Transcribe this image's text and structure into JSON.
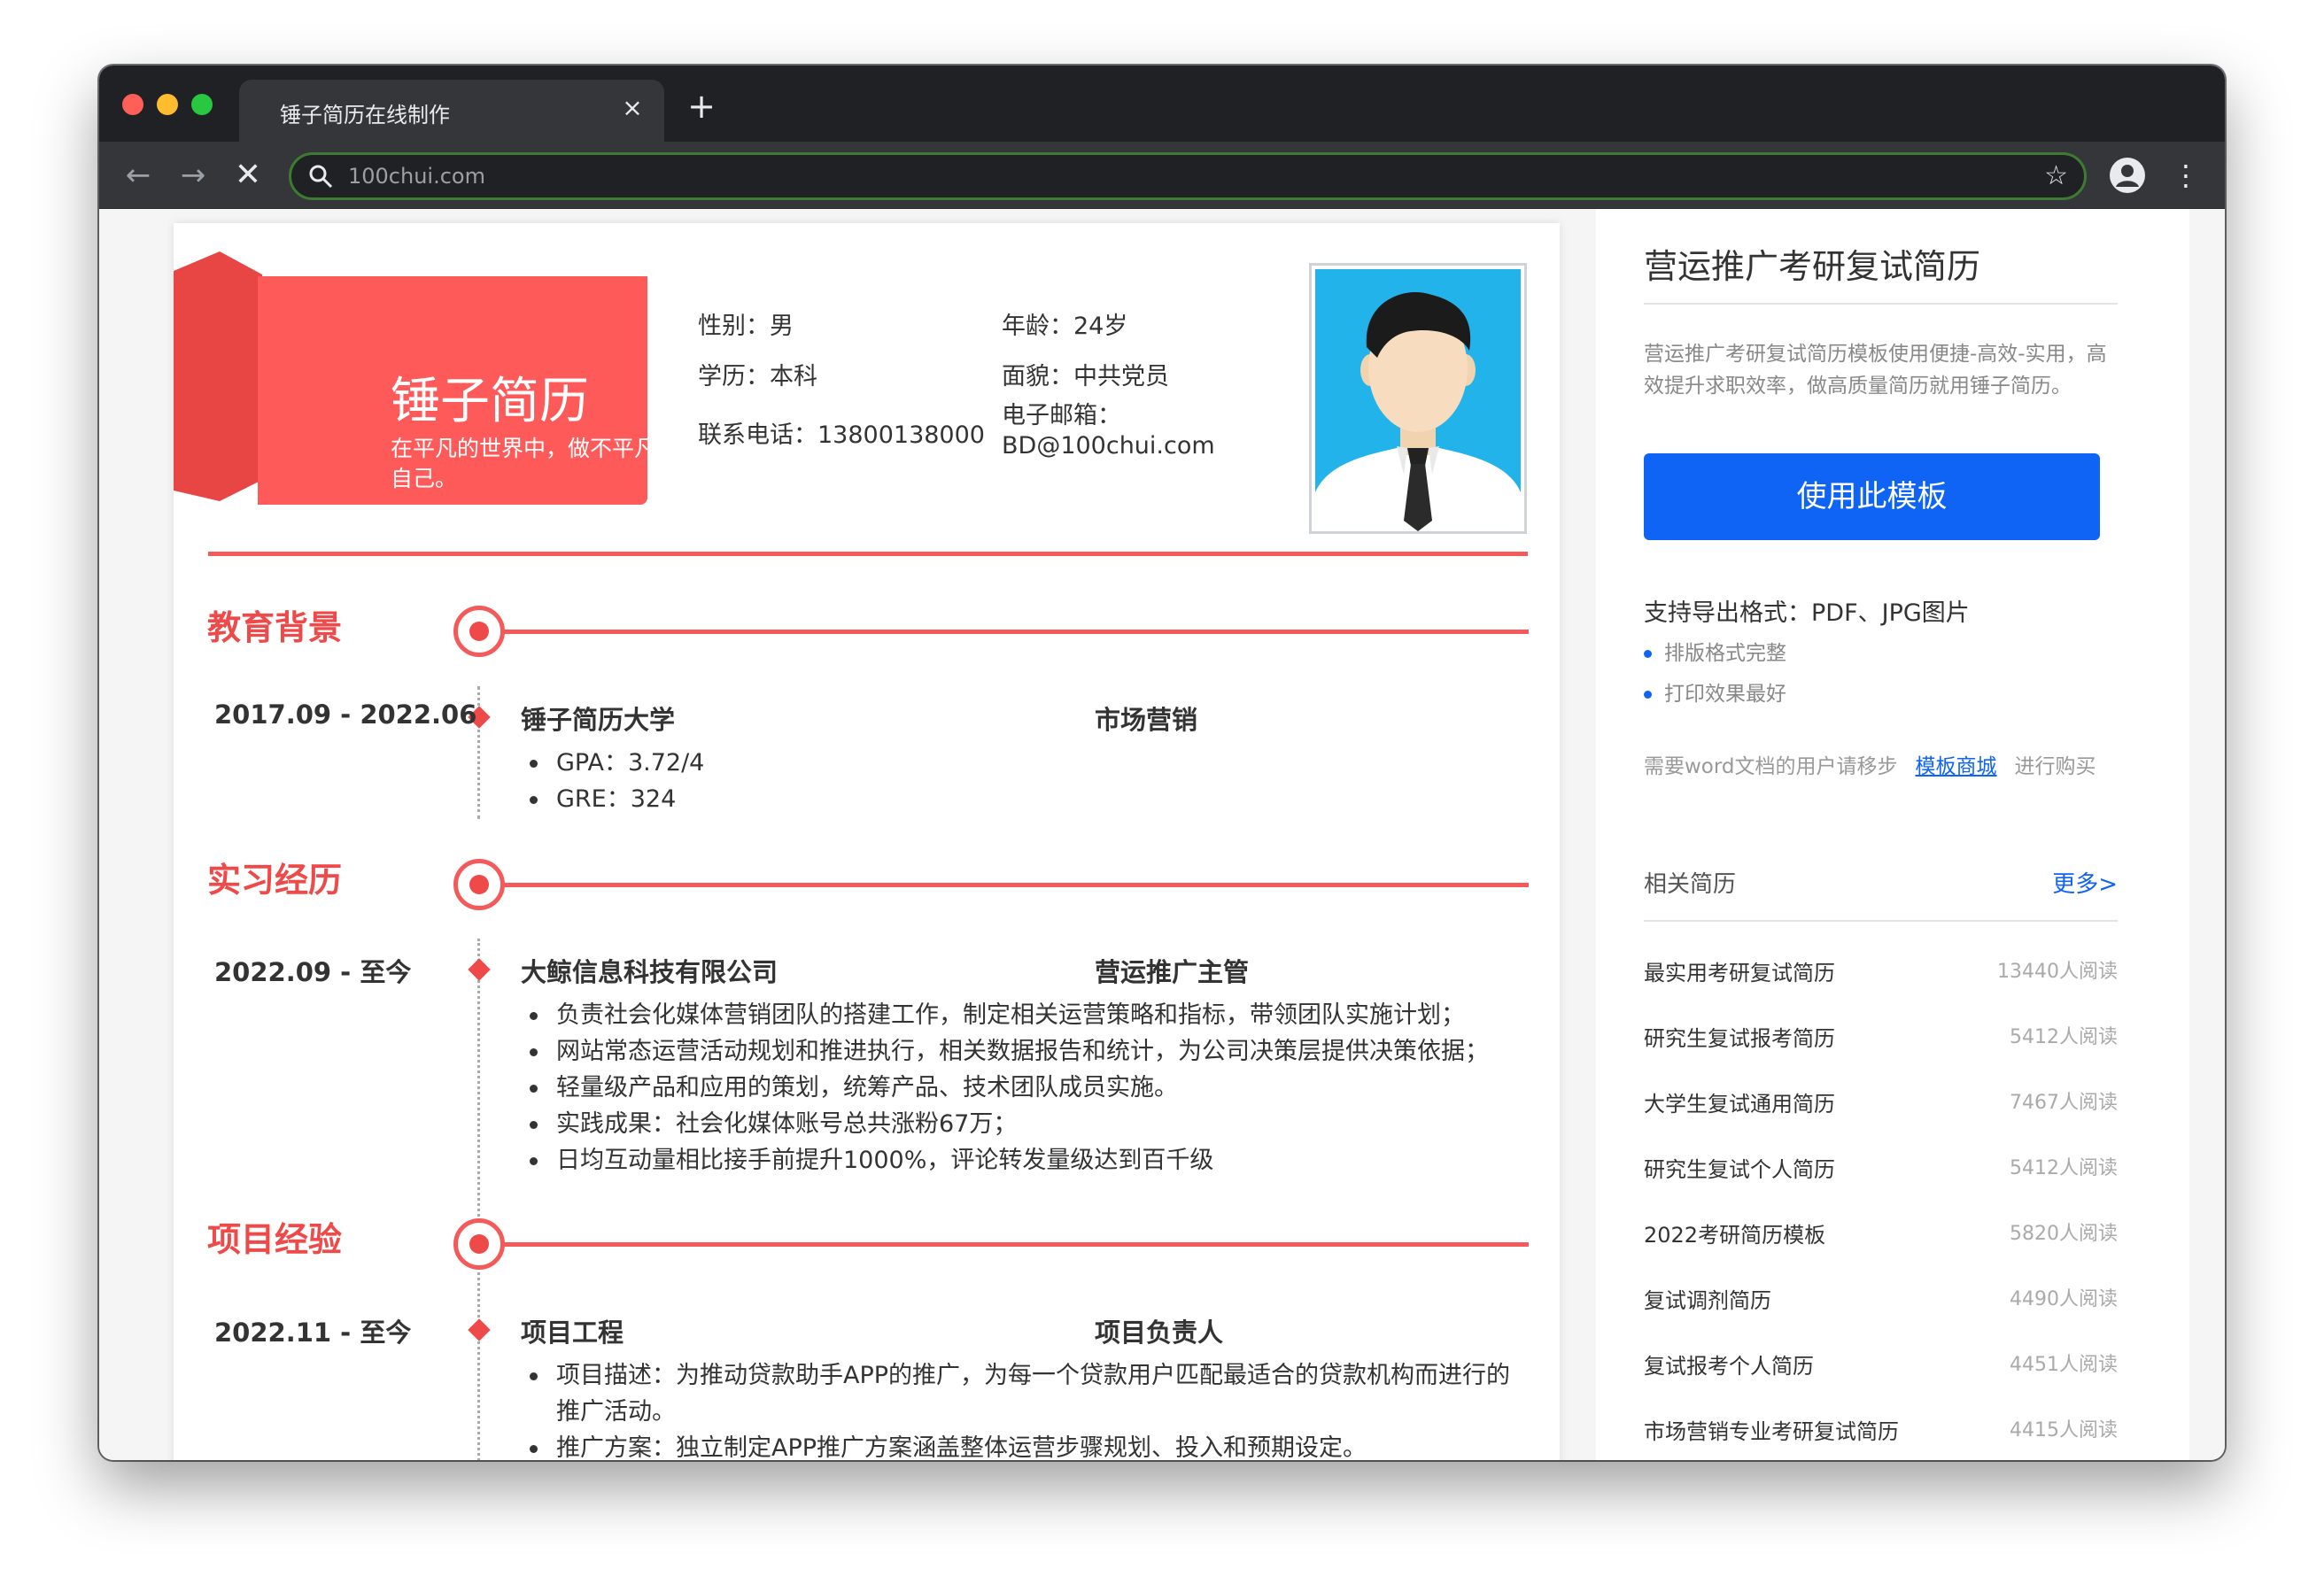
{
  "browser": {
    "tab_title": "锤子简历在线制作",
    "tab_close": "×",
    "new_tab": "+",
    "url": "100chui.com",
    "back": "←",
    "forward": "→",
    "stop": "✕",
    "star": "☆",
    "menu": "⋮"
  },
  "resume": {
    "brand_title": "锤子简历",
    "brand_slogan": "在平凡的世界中，做不平凡的自己。",
    "gender": "性别：男",
    "age": "年龄：24岁",
    "education": "学历：本科",
    "politics": "面貌：中共党员",
    "phone": "联系电话：13800138000",
    "email_label": "电子邮箱：",
    "email": "BD@100chui.com",
    "sections": [
      {
        "title": "教育背景",
        "date": "2017.09 - 2022.06",
        "org": "锤子简历大学",
        "role": "市场营销",
        "bullets": [
          "GPA：3.72/4",
          "GRE：324"
        ]
      },
      {
        "title": "实习经历",
        "date": "2022.09 - 至今",
        "org": "大鲸信息科技有限公司",
        "role": "营运推广主管",
        "bullets": [
          "负责社会化媒体营销团队的搭建工作，制定相关运营策略和指标，带领团队实施计划；",
          "网站常态运营活动规划和推进执行，相关数据报告和统计，为公司决策层提供决策依据；",
          "轻量级产品和应用的策划，统筹产品、技术团队成员实施。",
          "实践成果：社会化媒体账号总共涨粉67万；",
          "日均互动量相比接手前提升1000%，评论转发量级达到百千级"
        ]
      },
      {
        "title": "项目经验",
        "date": "2022.11 - 至今",
        "org": "项目工程",
        "role": "项目负责人",
        "bullets": [
          "项目描述：为推动贷款助手APP的推广，为每一个贷款用户匹配最适合的贷款机构而进行的推广活动。",
          "推广方案：独立制定APP推广方案涵盖整体运营步骤规划、投入和预期设定。"
        ]
      }
    ]
  },
  "sidebar": {
    "title": "营运推广考研复试简历",
    "description": "营运推广考研复试简历模板使用便捷-高效-实用，高效提升求职效率，做高质量简历就用锤子简历。",
    "use_button": "使用此模板",
    "export_formats": "支持导出格式：PDF、JPG图片",
    "features": [
      "排版格式完整",
      "打印效果最好"
    ],
    "word_note_prefix": "需要word文档的用户请移步",
    "word_note_link": "模板商城",
    "word_note_suffix": "进行购买",
    "related_title": "相关简历",
    "more": "更多>",
    "related": [
      {
        "name": "最实用考研复试简历",
        "views": "13440人阅读"
      },
      {
        "name": "研究生复试报考简历",
        "views": "5412人阅读"
      },
      {
        "name": "大学生复试通用简历",
        "views": "7467人阅读"
      },
      {
        "name": "研究生复试个人简历",
        "views": "5412人阅读"
      },
      {
        "name": "2022考研简历模板",
        "views": "5820人阅读"
      },
      {
        "name": "复试调剂简历",
        "views": "4490人阅读"
      },
      {
        "name": "复试报考个人简历",
        "views": "4451人阅读"
      },
      {
        "name": "市场营销专业考研复试简历",
        "views": "4415人阅读"
      }
    ]
  },
  "colors": {
    "accent_red": "#ff5a5a",
    "accent_blue": "#1064f5"
  },
  "icons": [
    "search-icon",
    "star-icon",
    "profile-icon",
    "menu-icon",
    "back-arrow-icon",
    "forward-arrow-icon",
    "stop-icon",
    "close-icon"
  ]
}
